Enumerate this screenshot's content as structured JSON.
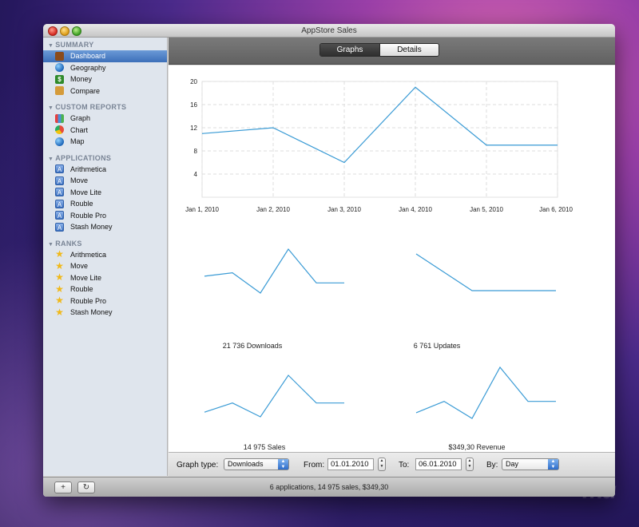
{
  "window": {
    "title": "AppStore Sales"
  },
  "sidebar": {
    "sections": [
      {
        "label": "SUMMARY",
        "items": [
          {
            "label": "Dashboard",
            "icon": "dashboard-icon"
          },
          {
            "label": "Geography",
            "icon": "globe-icon"
          },
          {
            "label": "Money",
            "icon": "money-icon"
          },
          {
            "label": "Compare",
            "icon": "compare-icon"
          }
        ]
      },
      {
        "label": "CUSTOM REPORTS",
        "items": [
          {
            "label": "Graph",
            "icon": "bar-graph-icon"
          },
          {
            "label": "Chart",
            "icon": "pie-chart-icon"
          },
          {
            "label": "Map",
            "icon": "globe-icon"
          }
        ]
      },
      {
        "label": "APPLICATIONS",
        "items": [
          {
            "label": "Arithmetica",
            "icon": "app-icon"
          },
          {
            "label": "Move",
            "icon": "app-icon"
          },
          {
            "label": "Move Lite",
            "icon": "app-icon"
          },
          {
            "label": "Rouble",
            "icon": "app-icon"
          },
          {
            "label": "Rouble Pro",
            "icon": "app-icon"
          },
          {
            "label": "Stash Money",
            "icon": "app-icon"
          }
        ]
      },
      {
        "label": "RANKS",
        "items": [
          {
            "label": "Arithmetica",
            "icon": "star-icon"
          },
          {
            "label": "Move",
            "icon": "star-icon"
          },
          {
            "label": "Move Lite",
            "icon": "star-icon"
          },
          {
            "label": "Rouble",
            "icon": "star-icon"
          },
          {
            "label": "Rouble Pro",
            "icon": "star-icon"
          },
          {
            "label": "Stash Money",
            "icon": "star-icon"
          }
        ]
      }
    ],
    "selected": "Dashboard"
  },
  "tabs": {
    "graphs": "Graphs",
    "details": "Details",
    "active": "Graphs"
  },
  "chart_data": [
    {
      "type": "line",
      "categories": [
        "Jan 1, 2010",
        "Jan 2, 2010",
        "Jan 3, 2010",
        "Jan 4, 2010",
        "Jan 5, 2010",
        "Jan 6, 2010"
      ],
      "values": [
        11,
        12,
        6,
        19,
        9,
        9
      ],
      "ylim": [
        0,
        20
      ],
      "yticks": [
        4,
        8,
        12,
        16,
        20
      ],
      "grid": true,
      "color": "#3a9bd5"
    },
    {
      "type": "line",
      "title": "21 736 Downloads",
      "values": [
        11,
        12,
        6,
        19,
        9,
        9
      ],
      "color": "#3a9bd5"
    },
    {
      "type": "line",
      "title": "6 761 Updates",
      "values": [
        13,
        10,
        7,
        7,
        7,
        7
      ],
      "color": "#3a9bd5"
    },
    {
      "type": "line",
      "title": "14 975 Sales",
      "values": [
        8,
        10,
        7,
        16,
        10,
        10
      ],
      "color": "#3a9bd5"
    },
    {
      "type": "line",
      "title": "$349,30 Revenue",
      "values": [
        10,
        12,
        9,
        18,
        12,
        12
      ],
      "color": "#3a9bd5"
    }
  ],
  "footer": {
    "graph_type_label": "Graph type:",
    "graph_type_value": "Downloads",
    "from_label": "From:",
    "from_value": "01.01.2010",
    "to_label": "To:",
    "to_value": "06.01.2010",
    "by_label": "By:",
    "by_value": "Day"
  },
  "status": "6 applications, 14 975 sales, $349,30",
  "bottom_buttons": {
    "add": "+",
    "refresh": "↻"
  }
}
